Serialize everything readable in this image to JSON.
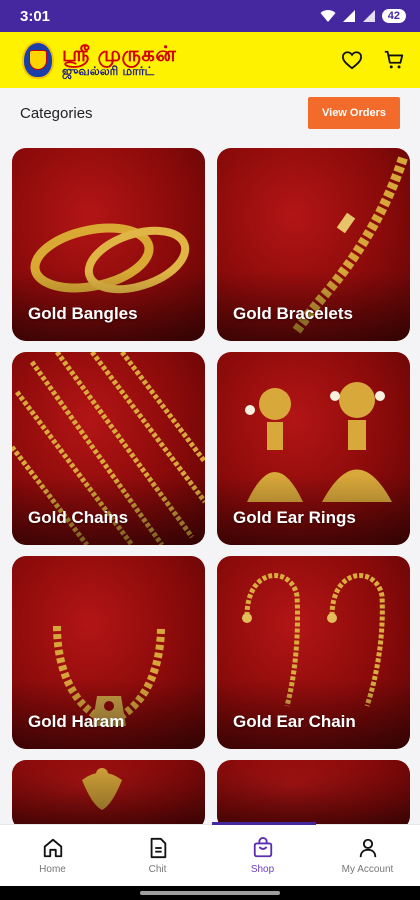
{
  "status_bar": {
    "time": "3:01",
    "battery": "42"
  },
  "header": {
    "brand_line1": "ஸ்ரீ முருகன்",
    "brand_line2": "ஜுவல்லரி மார்ட்",
    "wishlist_icon": "heart-icon",
    "cart_icon": "cart-icon"
  },
  "categories": {
    "title": "Categories",
    "view_orders_label": "View Orders",
    "items": [
      {
        "label": "Gold Bangles"
      },
      {
        "label": "Gold Bracelets"
      },
      {
        "label": "Gold Chains"
      },
      {
        "label": "Gold Ear Rings"
      },
      {
        "label": "Gold Haram"
      },
      {
        "label": "Gold Ear Chain"
      }
    ]
  },
  "nav": {
    "items": [
      {
        "label": "Home",
        "icon": "home-icon"
      },
      {
        "label": "Chit",
        "icon": "document-icon"
      },
      {
        "label": "Shop",
        "icon": "shopping-bag-icon",
        "active": true
      },
      {
        "label": "My Account",
        "icon": "person-icon"
      }
    ]
  },
  "colors": {
    "status_bar": "#4527a0",
    "header_bg": "#fff200",
    "brand_red": "#d30000",
    "accent_orange": "#f26b2b",
    "active_nav": "#6a3fc1"
  }
}
